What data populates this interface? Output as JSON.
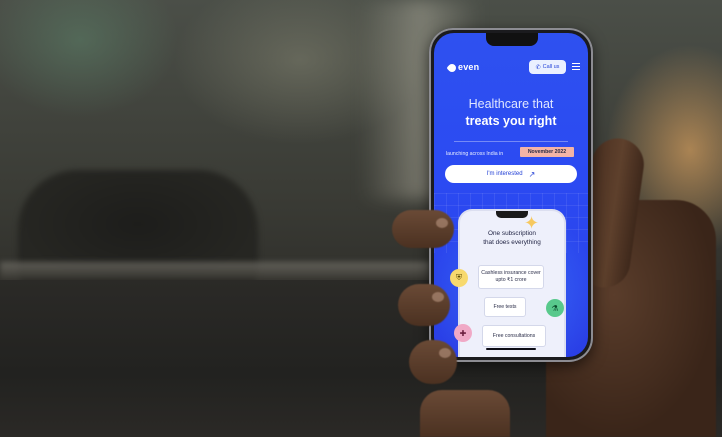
{
  "app": {
    "brand": "even",
    "call_label": "Call us",
    "headline_line1": "Healthcare that",
    "headline_line2": "treats you right",
    "launch_text": "launching across India in",
    "launch_date": "November 2022",
    "cta_label": "I'm interested",
    "subscription_title_line1": "One subscription",
    "subscription_title_line2": "that does everything",
    "features": [
      {
        "label": "Cashless insurance cover upto ₹1 crore",
        "icon": "shield-icon"
      },
      {
        "label": "Free tests",
        "icon": "test-tube-icon"
      },
      {
        "label": "Free consultations",
        "icon": "stethoscope-icon"
      }
    ]
  },
  "colors": {
    "brand_blue": "#2b4af2",
    "date_badge": "#f3b4a6",
    "sparkle": "#f6c85f",
    "feature_yellow": "#f7d96e",
    "feature_green": "#58c98c",
    "feature_pink": "#f0a9c6"
  }
}
